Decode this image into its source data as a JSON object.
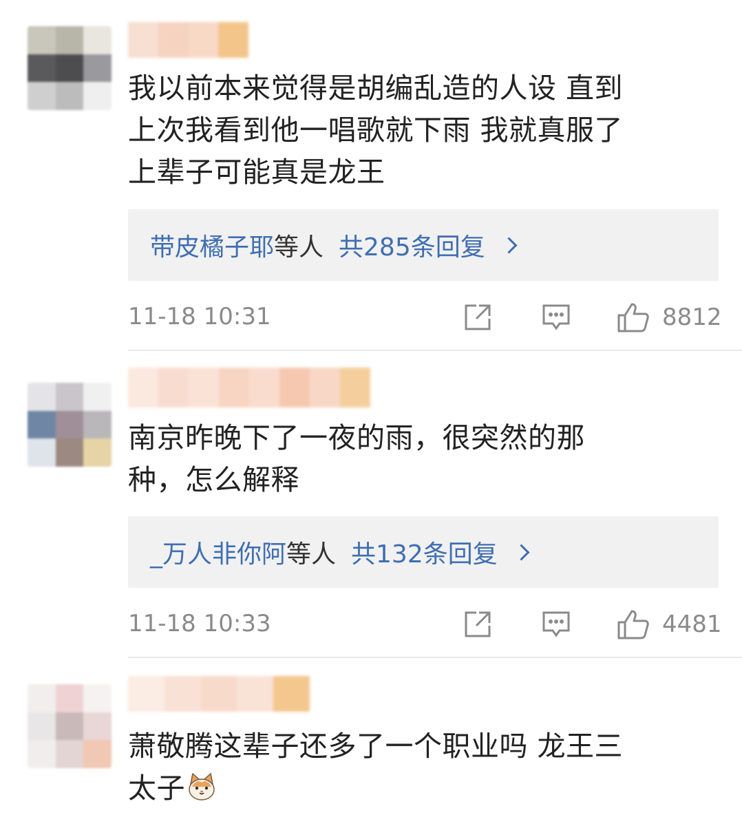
{
  "comments": [
    {
      "text": "我以前本来觉得是胡编乱造的人设 直到上次我看到他一唱歌就下雨 我就真服了 上辈子可能真是龙王",
      "lines": [
        "我以前本来觉得是胡编乱造的人设 直到",
        "上次我看到他一唱歌就下雨 我就真服了",
        "上辈子可能真是龙王"
      ],
      "reply_names": "带皮橘子耶",
      "reply_suffix": "等人",
      "reply_count": "共285条回复",
      "timestamp": "11-18 10:31",
      "like_count": "8812"
    },
    {
      "text": "南京昨晚下了一夜的雨，很突然的那种，怎么解释",
      "lines": [
        "南京昨晚下了一夜的雨，很突然的那",
        "种，怎么解释"
      ],
      "reply_names": "_万人非你阿",
      "reply_suffix": "等人",
      "reply_count": "共132条回复",
      "timestamp": "11-18 10:33",
      "like_count": "4481"
    },
    {
      "text": "萧敬腾这辈子还多了一个职业吗 龙王三太子",
      "lines": [
        "萧敬腾这辈子还多了一个职业吗 龙王三",
        "太子"
      ],
      "emoji": "cat-face-emoji"
    }
  ],
  "icons": {
    "share": "share-icon",
    "comment": "comment-icon",
    "like": "thumbs-up-icon"
  },
  "colors": {
    "link": "#3f6eb1",
    "meta": "#8a8a8a",
    "reply_bg": "#f1f1f1",
    "text": "#222222"
  }
}
